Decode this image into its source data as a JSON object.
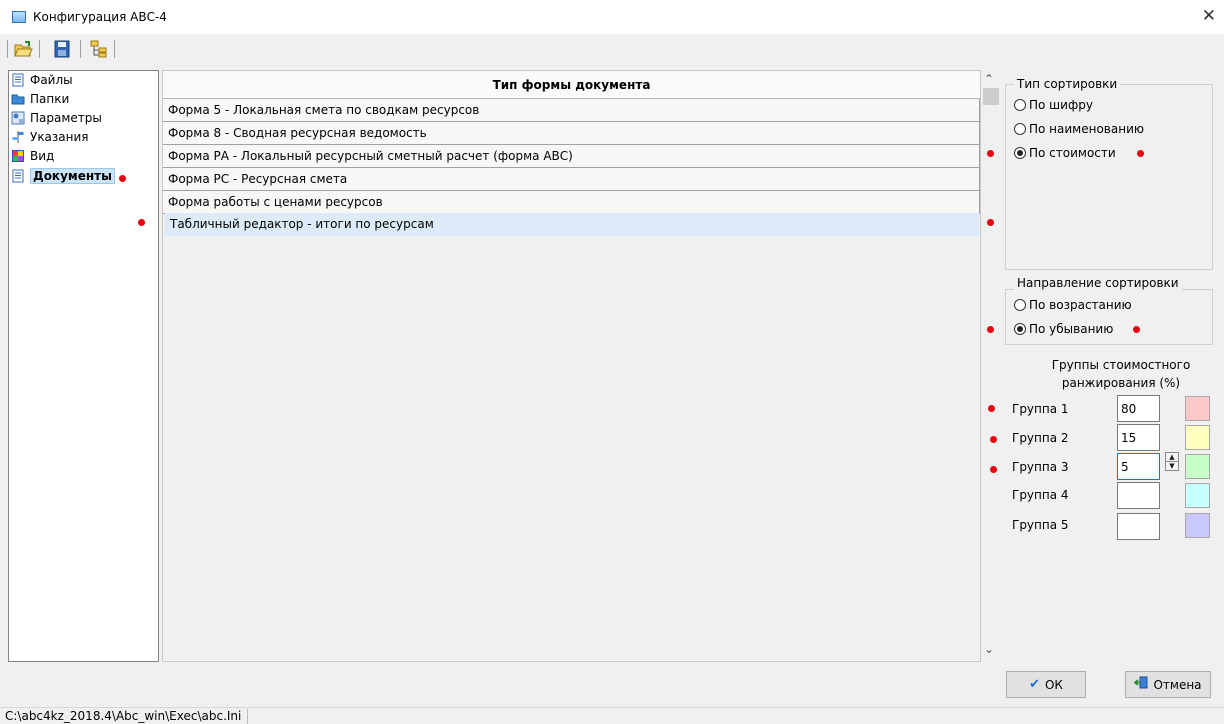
{
  "window": {
    "title": "Конфигурация АВС-4",
    "close_glyph": "✕"
  },
  "toolbar": {
    "buttons": [
      {
        "icon": "open-folder-icon"
      },
      {
        "icon": "save-icon"
      },
      {
        "icon": "tree-icon"
      }
    ]
  },
  "tree": {
    "items": [
      {
        "label": "Файлы",
        "icon": "file-icon"
      },
      {
        "label": "Папки",
        "icon": "folder-icon"
      },
      {
        "label": "Параметры",
        "icon": "parameters-icon"
      },
      {
        "label": "Указания",
        "icon": "directions-icon"
      },
      {
        "label": "Вид",
        "icon": "view-icon"
      },
      {
        "label": "Документы",
        "icon": "documents-icon",
        "selected": true
      }
    ]
  },
  "grid": {
    "header": "Тип формы документа",
    "rows": [
      "Форма 5 - Локальная смета по сводкам ресурсов",
      "Форма 8 - Сводная ресурсная ведомость",
      "Форма РА - Локальный ресурсный сметный расчет (форма АВС)",
      "Форма РС - Ресурсная смета",
      "Форма работы с ценами ресурсов",
      "Табличный редактор - итоги по ресурсам"
    ],
    "selected_index": 5
  },
  "sort_type": {
    "title": "Тип сортировки",
    "options": [
      "По шифру",
      "По наименованию",
      "По стоимости"
    ],
    "selected": 2
  },
  "sort_direction": {
    "title": "Направление сортировки",
    "options": [
      "По возрастанию",
      "По убыванию"
    ],
    "selected": 1
  },
  "groups": {
    "title_line1": "Группы стоимостного",
    "title_line2": "ранжирования (%)",
    "items": [
      {
        "label": "Группа 1",
        "value": "80",
        "color": "#ffc8c8"
      },
      {
        "label": "Группа 2",
        "value": "15",
        "color": "#ffffc0"
      },
      {
        "label": "Группа 3",
        "value": "5",
        "color": "#c8ffc8"
      },
      {
        "label": "Группа 4",
        "value": "",
        "color": "#c8ffff"
      },
      {
        "label": "Группа 5",
        "value": "",
        "color": "#c8c8ff"
      }
    ]
  },
  "buttons": {
    "ok": "ОК",
    "cancel": "Отмена"
  },
  "status": {
    "path": "C:\\abc4kz_2018.4\\Abc_win\\Exec\\abc.Ini"
  },
  "marker_color": "#e8000c"
}
